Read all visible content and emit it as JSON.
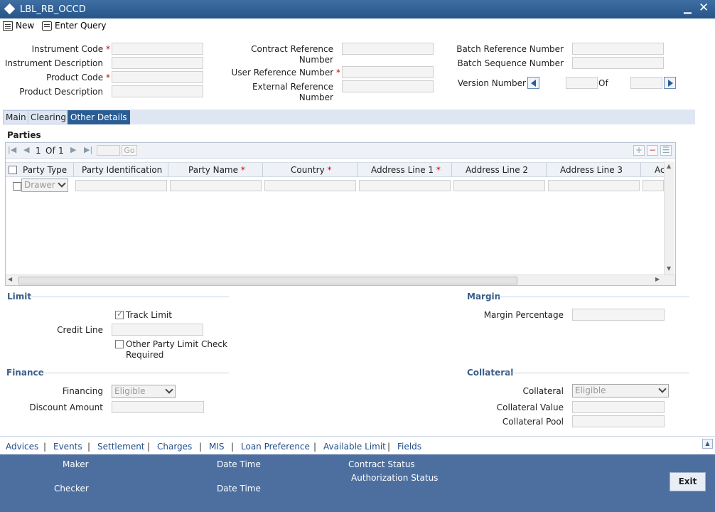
{
  "window": {
    "title": "LBL_RB_OCCD"
  },
  "toolbar": {
    "new_label": "New",
    "enter_query_label": "Enter Query"
  },
  "header": {
    "instrument_code": "Instrument Code",
    "instrument_description": "Instrument Description",
    "product_code": "Product Code",
    "product_description": "Product Description",
    "contract_reference_1": "Contract Reference",
    "contract_reference_2": "Number",
    "user_reference_number": "User Reference Number",
    "external_reference_1": "External Reference",
    "external_reference_2": "Number",
    "batch_reference_number": "Batch Reference Number",
    "batch_sequence_number": "Batch Sequence Number",
    "version_number": "Version Number",
    "of": "Of",
    "required_mark": "*"
  },
  "tabs": [
    {
      "label": "Main",
      "active": false
    },
    {
      "label": "Clearing",
      "active": false
    },
    {
      "label": "Other Details",
      "active": true
    }
  ],
  "parties": {
    "title": "Parties",
    "pager": {
      "current": "1",
      "of_label": "Of",
      "total": "1",
      "go_label": "Go"
    },
    "columns": [
      {
        "label": "Party Type",
        "required": false
      },
      {
        "label": "Party Identification",
        "required": false
      },
      {
        "label": "Party Name",
        "required": true
      },
      {
        "label": "Country",
        "required": true
      },
      {
        "label": "Address Line 1",
        "required": true
      },
      {
        "label": "Address Line 2",
        "required": false
      },
      {
        "label": "Address Line 3",
        "required": false
      },
      {
        "label": "Ac",
        "required": false
      }
    ],
    "row": {
      "party_type": "Drawer"
    }
  },
  "limit": {
    "title": "Limit",
    "track_limit": "Track Limit",
    "credit_line": "Credit Line",
    "other_party_1": "Other Party Limit Check",
    "other_party_2": "Required"
  },
  "margin": {
    "title": "Margin",
    "margin_percentage": "Margin Percentage"
  },
  "finance": {
    "title": "Finance",
    "financing": "Financing",
    "financing_value": "Eligible",
    "discount_amount": "Discount Amount"
  },
  "collateral": {
    "title": "Collateral",
    "collateral": "Collateral",
    "collateral_value_select": "Eligible",
    "collateral_value": "Collateral Value",
    "collateral_pool": "Collateral Pool"
  },
  "links": [
    "Advices",
    "Events",
    "Settlement",
    "Charges",
    "MIS",
    "Loan Preference",
    "Available Limit",
    "Fields"
  ],
  "link_separator": "|",
  "footer": {
    "maker": "Maker",
    "date_time": "Date Time",
    "checker": "Checker",
    "contract_status": "Contract Status",
    "authorization_status": "Authorization Status",
    "exit_label": "Exit"
  }
}
